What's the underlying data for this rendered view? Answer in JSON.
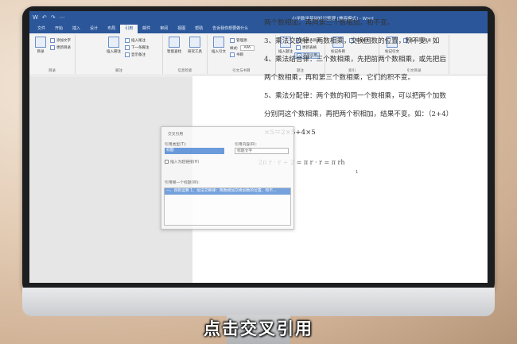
{
  "window": {
    "title": "小学数学基础知识整理 [兼容模式] - Word",
    "qat": [
      "W",
      "↶",
      "↷",
      "⋯"
    ]
  },
  "tabs": [
    {
      "label": "文件"
    },
    {
      "label": "开始"
    },
    {
      "label": "插入"
    },
    {
      "label": "设计"
    },
    {
      "label": "布局"
    },
    {
      "label": "引用",
      "active": true
    },
    {
      "label": "邮件"
    },
    {
      "label": "审阅"
    },
    {
      "label": "视图"
    },
    {
      "label": "帮助"
    },
    {
      "label": "告诉我你想要做什么"
    }
  ],
  "ribbon": {
    "toc": {
      "big": "目录",
      "add_text": "添加文字",
      "update": "更新目录",
      "label": "目录"
    },
    "footnotes": {
      "big": "插入脚注",
      "endnote": "插入尾注",
      "next": "下一条脚注",
      "show": "显示备注",
      "label": "脚注"
    },
    "research": {
      "smart": "智能查找",
      "researcher": "研究工具",
      "label": "信息检索"
    },
    "citations": {
      "insert": "插入引文",
      "manage": "管理源",
      "style_label": "样式:",
      "style_value": "APA",
      "bib": "书目",
      "label": "引文与书目"
    },
    "captions": {
      "big": "插入题注",
      "insert_table": "插入表目录",
      "update_table": "更新表格",
      "cross_ref": "交叉引用",
      "label": "题注"
    },
    "index": {
      "big": "标记条目",
      "insert": "插入索引",
      "label": "索引"
    },
    "authorities": {
      "big": "标记引文",
      "insert": "插入引文目录",
      "label": "引文目录"
    }
  },
  "document": {
    "lines": [
      "两个数相加，再同第三个数相加，和不变。",
      "3、乘法交换律：两数相乘，交换因数的位置，积不变。如",
      "4、乘法结合律：三个数相乘，先把前两个数相乘，或先把后",
      "两个数相乘，再和第三个数相乘，它们的积不变。",
      "5、乘法分配律：两个数的和同一个数相乘，可以把两个加数",
      "分别同这个数相乘，再把两个积相加，结果不变。如：（2+4）",
      "×5＝2×5+4×5"
    ],
    "equation": "2π r · r ÷ 2 = π r · r = π rh",
    "page_number": "1"
  },
  "dialog": {
    "title": "交叉引用",
    "ref_type_label": "引用类型(T):",
    "ref_type_value": "标题",
    "ref_content_label": "引用内容(R):",
    "ref_content_value": "标题文字",
    "hyperlink_label": "插入为超链接(H)",
    "for_which_label": "引用哪一个标题(W):",
    "item": "一、四则运算 1、加法交换律：两数相加交换加数的位置，和不..."
  },
  "caption": "点击交叉引用"
}
